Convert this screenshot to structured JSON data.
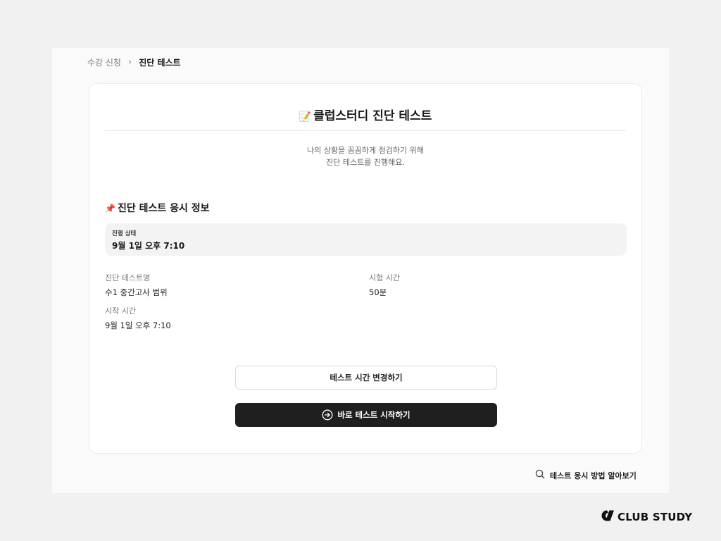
{
  "breadcrumb": {
    "previous": "수강 신청",
    "separator": "›",
    "current": "진단 테스트"
  },
  "card": {
    "title_emoji": "📝",
    "title": "클럽스터디 진단 테스트",
    "subtitle_line1": "나의 상황을 꼼꼼하게 점검하기 위해",
    "subtitle_line2": "진단 테스트를 진행해요."
  },
  "info_section": {
    "title_emoji": "📌",
    "title": "진단 테스트 응시 정보",
    "status_label": "진행 상태",
    "status_value": "9월 1일 오후 7:10",
    "test_name_label": "진단 테스트명",
    "test_name_value": "수1 중간고사 범위",
    "duration_label": "시험 시간",
    "duration_value": "50분",
    "start_time_label": "시작 시간",
    "start_time_value": "9월 1일 오후 7:10"
  },
  "buttons": {
    "change_time": "테스트 시간 변경하기",
    "start_now": "바로 테스트 시작하기"
  },
  "help_link": {
    "icon": "search-icon",
    "label": "테스트 응시 방법 알아보기"
  },
  "brand": {
    "logo": "club-study-logo",
    "name": "CLUB STUDY"
  },
  "colors": {
    "page_bg": "#f1f1f1",
    "card_bg": "#ffffff",
    "primary_button": "#1f1f1f",
    "status_box": "#f3f3f3"
  }
}
